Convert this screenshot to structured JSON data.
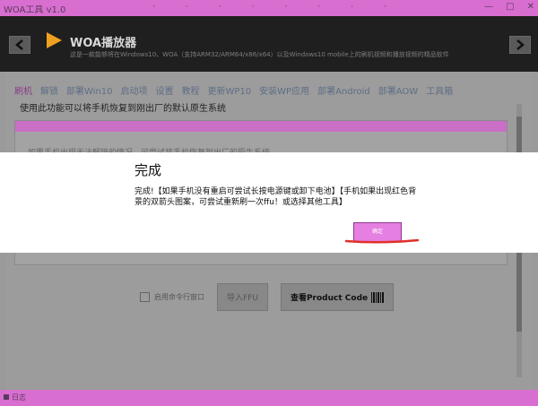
{
  "titlebar": {
    "app": "WOA工具 v1.0",
    "dots": [
      "·",
      "·",
      "·",
      "·",
      "·",
      "·",
      "·",
      "·"
    ],
    "winbtns": [
      "—",
      "□",
      "✕"
    ]
  },
  "header": {
    "title": "WOA播放器",
    "description": "这是一款能够将在Windows10、WOA（支持ARM32/ARM64/x86/x64）以及Windows10 mobile上的刷机视频和播放视频的精品软件"
  },
  "tabs": [
    "刷机",
    "解锁",
    "部署Win10",
    "启动项",
    "设置",
    "教程",
    "更新WP10",
    "安装WP应用",
    "部署Android",
    "部署AOW",
    "工具箱"
  ],
  "subtitle": "使用此功能可以将手机恢复到刚出厂的默认原生系统",
  "box": {
    "line": "如果手机出现无法解锁的情况，可尝试将手机恢复到出厂的原生系统"
  },
  "options": {
    "checkbox_label": "启用命令行窗口",
    "import_ffu": "导入FFU",
    "product_code": "查看Product Code"
  },
  "status": {
    "text": "日志"
  },
  "dialog": {
    "title": "完成",
    "message": "完成!【如果手机没有重启可尝试长按电源键或卸下电池】【手机如果出现红色背景的双箭头图案，可尝试重新刷一次ffu！或选择其他工具】",
    "ok": "确定"
  },
  "colors": {
    "accent": "#d86ed0",
    "header_bg": "#1f1f1f",
    "logo": "#f0a020",
    "ok_button": "#e57fe2",
    "annotation": "#e0302a"
  }
}
